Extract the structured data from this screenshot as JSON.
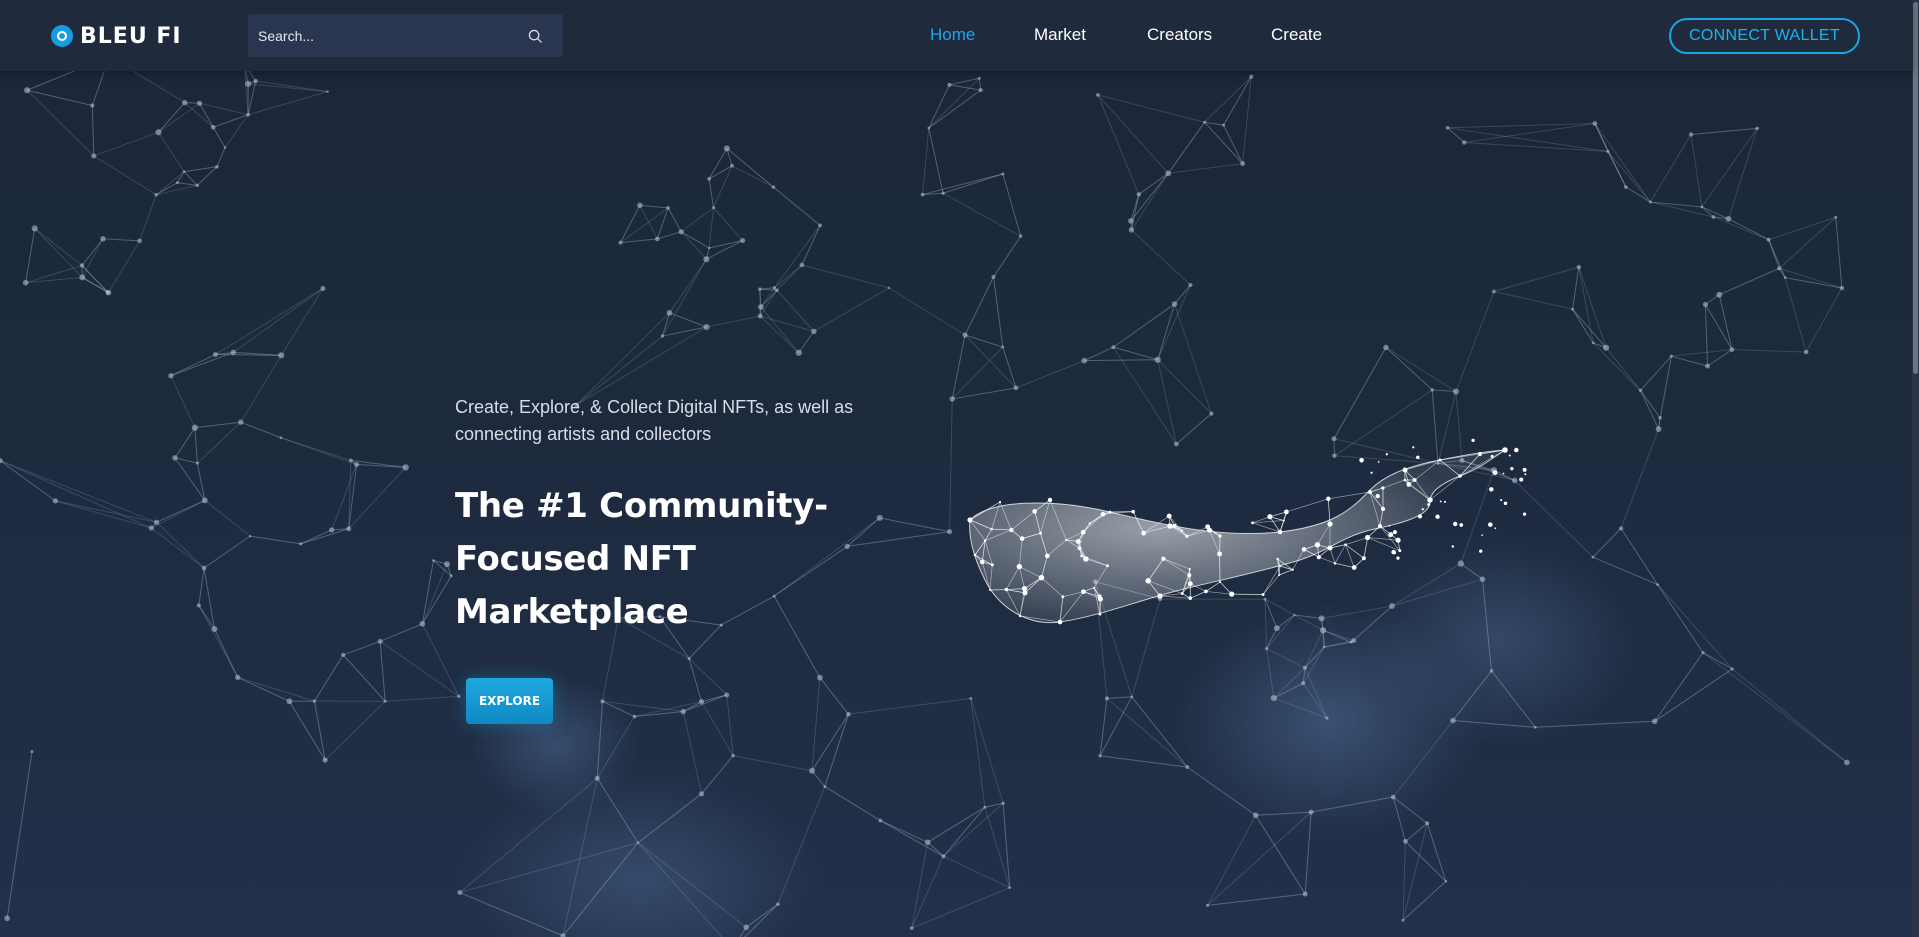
{
  "brand": {
    "name": "BLEU FI"
  },
  "search": {
    "placeholder": "Search..."
  },
  "nav": {
    "items": [
      {
        "label": "Home",
        "active": true
      },
      {
        "label": "Market",
        "active": false
      },
      {
        "label": "Creators",
        "active": false
      },
      {
        "label": "Create",
        "active": false
      }
    ]
  },
  "header": {
    "connect_label": "CONNECT WALLET"
  },
  "hero": {
    "subtitle": "Create, Explore, & Collect Digital NFTs, as well as connecting artists and collectors",
    "title": "The #1 Community-Focused NFT Marketplace",
    "cta_label": "EXPLORE"
  },
  "colors": {
    "accent": "#1ea5ee",
    "background": "#1d2a3f",
    "header": "#1f2a3d",
    "button": "#1289c4"
  },
  "icons": [
    "logo-mark-icon",
    "search-icon",
    "whale-illustration"
  ]
}
